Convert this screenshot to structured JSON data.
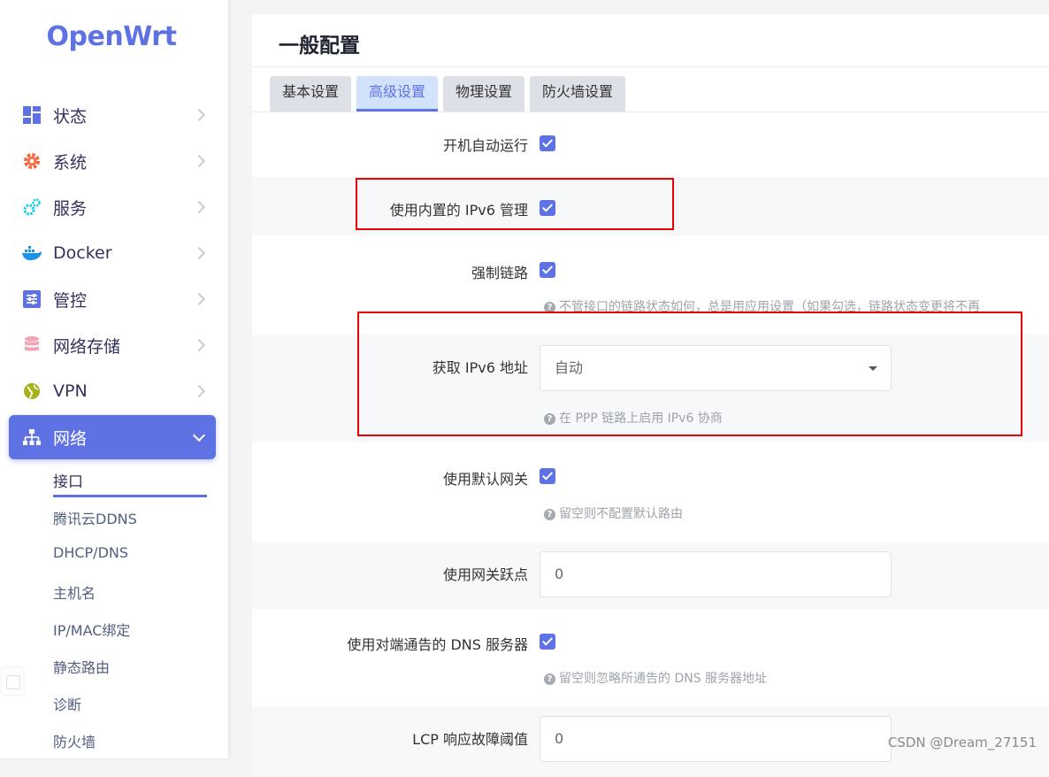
{
  "brand": {
    "logo": "OpenWrt",
    "accent": "#5e72e4"
  },
  "sidebar": {
    "items": [
      {
        "label": "状态",
        "icon": "dashboard-icon"
      },
      {
        "label": "系统",
        "icon": "gear-icon"
      },
      {
        "label": "服务",
        "icon": "cogs-icon"
      },
      {
        "label": "Docker",
        "icon": "docker-icon"
      },
      {
        "label": "管控",
        "icon": "sliders-icon"
      },
      {
        "label": "网络存储",
        "icon": "database-icon"
      },
      {
        "label": "VPN",
        "icon": "globe-icon"
      },
      {
        "label": "网络",
        "icon": "sitemap-icon",
        "active": true
      }
    ],
    "subitems": [
      {
        "label": "接口",
        "active": true
      },
      {
        "label": "腾讯云DDNS"
      },
      {
        "label": "DHCP/DNS"
      },
      {
        "label": "主机名"
      },
      {
        "label": "IP/MAC绑定"
      },
      {
        "label": "静态路由"
      },
      {
        "label": "诊断"
      },
      {
        "label": "防火墙"
      }
    ]
  },
  "main": {
    "title": "一般配置",
    "tabs": [
      {
        "label": "基本设置"
      },
      {
        "label": "高级设置",
        "active": true
      },
      {
        "label": "物理设置"
      },
      {
        "label": "防火墙设置"
      }
    ],
    "rows": [
      {
        "label": "开机自动运行",
        "type": "checkbox",
        "checked": true
      },
      {
        "label": "使用内置的 IPv6 管理",
        "type": "checkbox",
        "checked": true
      },
      {
        "label": "强制链路",
        "type": "checkbox",
        "checked": true,
        "hint": "不管接口的链路状态如何，总是用应用设置（如果勾选，链路状态变更将不再"
      },
      {
        "label": "获取 IPv6 地址",
        "type": "select",
        "value": "自动",
        "hint": "在 PPP 链路上启用 IPv6 协商"
      },
      {
        "label": "使用默认网关",
        "type": "checkbox",
        "checked": true,
        "hint": "留空则不配置默认路由"
      },
      {
        "label": "使用网关跃点",
        "type": "input",
        "value": "0"
      },
      {
        "label": "使用对端通告的 DNS 服务器",
        "type": "checkbox",
        "checked": true,
        "hint": "留空则忽略所通告的 DNS 服务器地址"
      },
      {
        "label": "LCP 响应故障阈值",
        "type": "input",
        "value": "0"
      }
    ]
  },
  "hint_icon": "question-circle-icon",
  "watermark": "CSDN @Dream_27151",
  "highlight_color": "#e00000"
}
